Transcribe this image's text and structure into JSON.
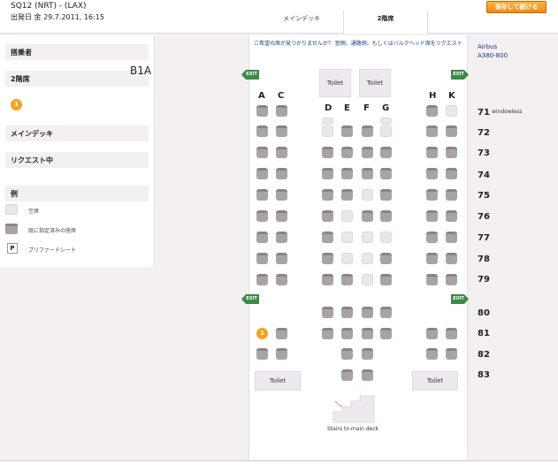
{
  "header": {
    "flight_code": "SQ12 (NRT) - (LAX)",
    "flight_date": "出発日 金 29.7.2011, 16:15",
    "tab_main": "メインデッキ",
    "tab_upper": "2階席",
    "save_button": "保存して続ける"
  },
  "left_panel": {
    "passenger_heading": "搭乗者",
    "upper_deck_heading": "2階席",
    "passenger_seat_badge": "1",
    "passenger_seat": "B1A",
    "main_deck_heading": "メインデッキ",
    "request_heading": "リクエスト中",
    "legend_heading": "例",
    "legend": [
      {
        "label": "空席",
        "icon": "available-seat"
      },
      {
        "label": "既に指定済みの座席",
        "icon": "occupied-seat"
      },
      {
        "label": "プリファードシート",
        "icon": "preferred-seat",
        "glyph": "P"
      }
    ]
  },
  "seat_map": {
    "instruction": "ご希望の席が見つかりませんか？ 窓側、通路側、もしくはバルクヘッド席をリクエスト",
    "aircraft_line1": "Airbus",
    "aircraft_line2": "A380-800",
    "columns": [
      "A",
      "C",
      "D",
      "E",
      "F",
      "G",
      "H",
      "K"
    ],
    "rows": [
      "71",
      "72",
      "73",
      "74",
      "75",
      "76",
      "77",
      "78",
      "79",
      "80",
      "81",
      "82",
      "83"
    ],
    "window_note": "windowless",
    "toilet_label": "Toilet",
    "exit_label": "EXIT",
    "selected_seat_label": "1",
    "stairs_label": "Stairs to main deck"
  },
  "colors": {
    "background": "#f3eff3",
    "occupied": "#a9a3a9",
    "available": "#ebe6eb",
    "selected": "#f6a21d",
    "exit": "#3d8a44",
    "save_button": "#f08a10",
    "link": "#1d3a7a"
  }
}
